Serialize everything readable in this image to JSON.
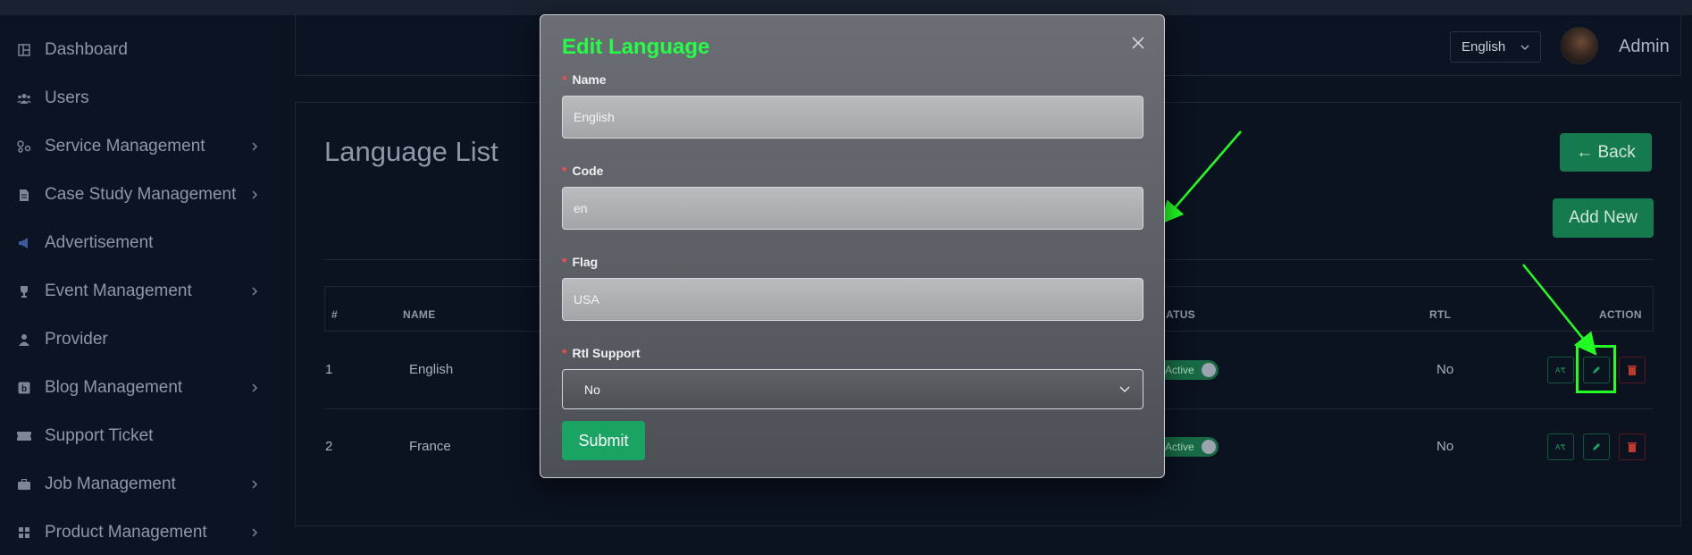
{
  "sidebar": {
    "items": [
      {
        "label": "Dashboard",
        "icon": "dashboard-icon",
        "has_submenu": false
      },
      {
        "label": "Users",
        "icon": "users-icon",
        "has_submenu": false
      },
      {
        "label": "Service Management",
        "icon": "services-icon",
        "has_submenu": true
      },
      {
        "label": "Case Study Management",
        "icon": "document-icon",
        "has_submenu": true
      },
      {
        "label": "Advertisement",
        "icon": "megaphone-icon",
        "has_submenu": false
      },
      {
        "label": "Event Management",
        "icon": "trophy-icon",
        "has_submenu": true
      },
      {
        "label": "Provider",
        "icon": "user-icon",
        "has_submenu": false
      },
      {
        "label": "Blog Management",
        "icon": "blog-icon",
        "has_submenu": true
      },
      {
        "label": "Support Ticket",
        "icon": "ticket-icon",
        "has_submenu": false
      },
      {
        "label": "Job Management",
        "icon": "briefcase-icon",
        "has_submenu": true
      },
      {
        "label": "Product Management",
        "icon": "grid-icon",
        "has_submenu": true
      }
    ]
  },
  "header": {
    "language_selected": "English",
    "user_name": "Admin"
  },
  "page": {
    "title": "Language List",
    "back_label": "← Back",
    "add_new_label": "Add New"
  },
  "table": {
    "columns": [
      "#",
      "NAME",
      "ATUS",
      "RTL",
      "ACTION"
    ],
    "rows": [
      {
        "index": "1",
        "name": "English",
        "status": "Active",
        "rtl": "No"
      },
      {
        "index": "2",
        "name": "France",
        "status": "Active",
        "rtl": "No"
      }
    ]
  },
  "modal": {
    "title": "Edit Language",
    "required_mark": "*",
    "fields": {
      "name": {
        "label": "Name",
        "value": "English"
      },
      "code": {
        "label": "Code",
        "value": "en"
      },
      "flag": {
        "label": "Flag",
        "value": "USA"
      },
      "rtl": {
        "label": "Rtl Support",
        "value": "No"
      }
    },
    "submit_label": "Submit"
  },
  "colors": {
    "accent_green": "#1aa463",
    "title_green": "#22ff44",
    "annotation_green": "#22ff22",
    "danger_red": "#c0392b"
  }
}
